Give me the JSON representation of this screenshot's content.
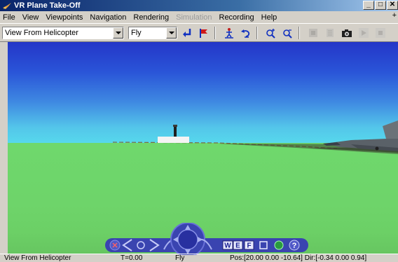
{
  "window": {
    "title": "VR Plane Take-Off",
    "minimize": "_",
    "maximize": "□",
    "close": "✕"
  },
  "menu": {
    "items": [
      {
        "label": "File",
        "enabled": true
      },
      {
        "label": "View",
        "enabled": true
      },
      {
        "label": "Viewpoints",
        "enabled": true
      },
      {
        "label": "Navigation",
        "enabled": true
      },
      {
        "label": "Rendering",
        "enabled": true
      },
      {
        "label": "Simulation",
        "enabled": false
      },
      {
        "label": "Recording",
        "enabled": true
      },
      {
        "label": "Help",
        "enabled": true
      }
    ],
    "extra": "+"
  },
  "toolbar": {
    "viewpoint_value": "View From Helicopter",
    "nav_mode_value": "Fly"
  },
  "statusbar": {
    "viewpoint": "View From Helicopter",
    "time": "T=0.00",
    "mode": "Fly",
    "position": "Pos:[20.00 0.00 -10.64] Dir:[-0.34 0.00 0.94]"
  },
  "nav_panel": {
    "w_label": "W",
    "e_label": "E",
    "f_label": "F",
    "help_label": "?"
  },
  "colors": {
    "sky_top": "#2436c8",
    "sky_horizon": "#56d8ec",
    "ground": "#6fd86c",
    "nav_panel": "#3a44b0"
  }
}
